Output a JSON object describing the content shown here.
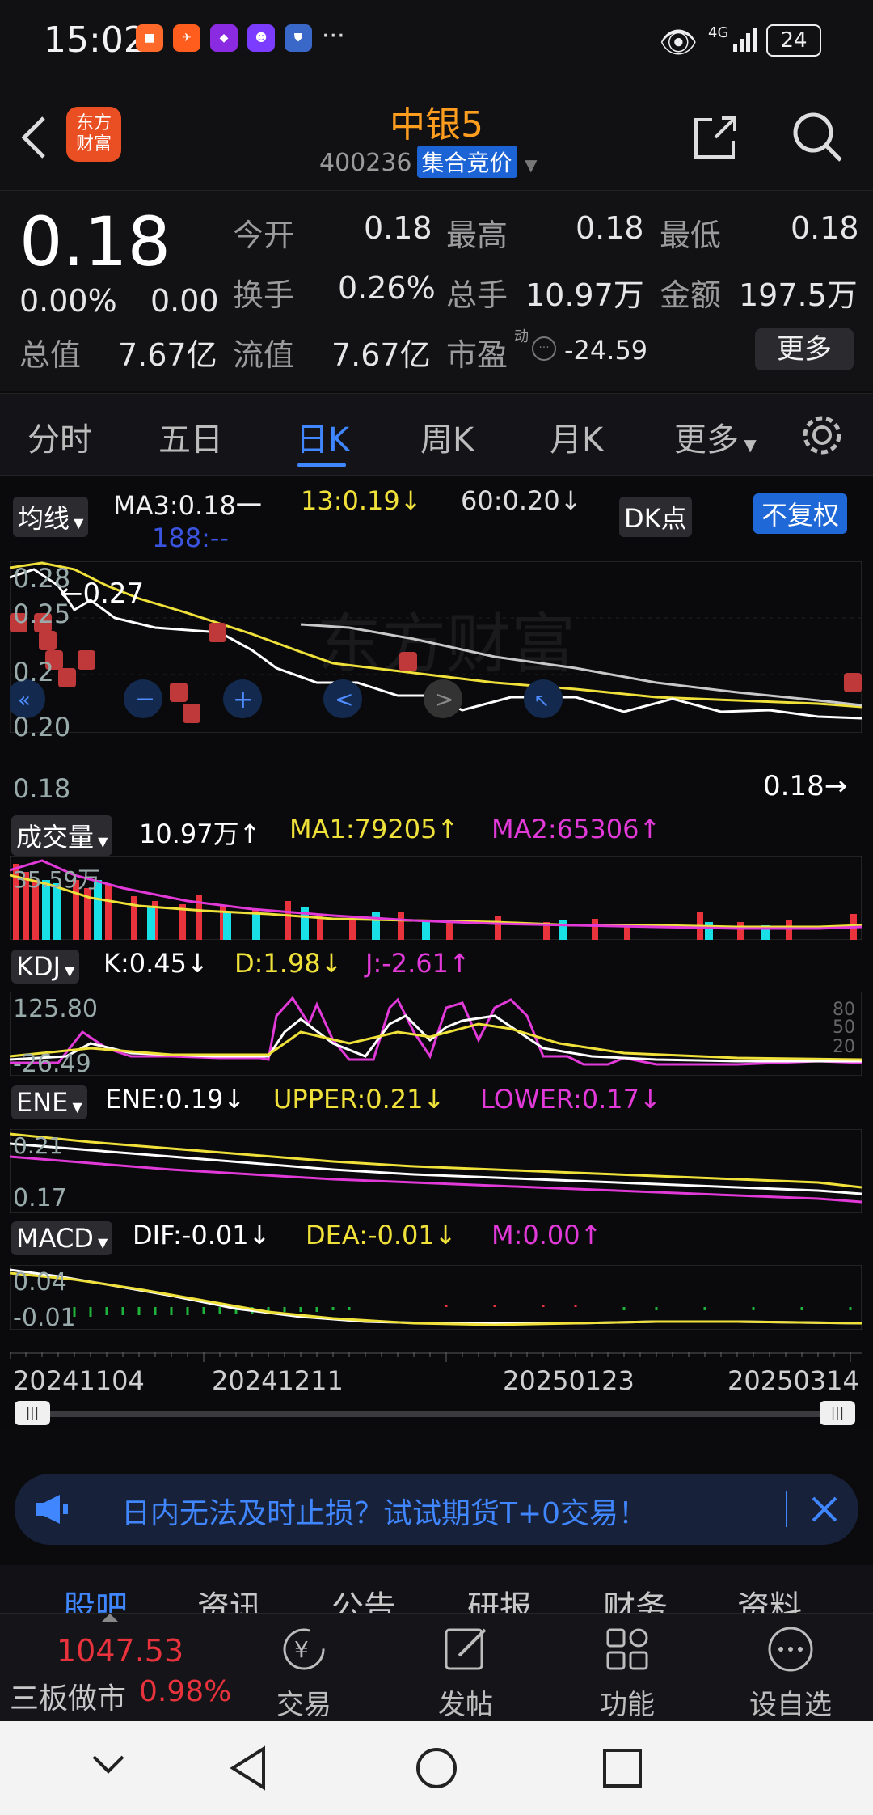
{
  "status_bar": {
    "time": "15:02",
    "network": "4G",
    "battery": "24"
  },
  "header": {
    "title": "中银5",
    "code": "400236",
    "auction_badge": "集合竞价",
    "logo_line1": "东方",
    "logo_line2": "财富"
  },
  "quote": {
    "price": "0.18",
    "change_pct": "0.00%",
    "change": "0.00",
    "labels": {
      "open": "今开",
      "high": "最高",
      "low": "最低",
      "turnover": "换手",
      "volume": "总手",
      "amount": "金额",
      "total_value": "总值",
      "float_value": "流值",
      "pe": "市盈",
      "pe_mark": "动"
    },
    "values": {
      "open": "0.18",
      "high": "0.18",
      "low": "0.18",
      "turnover": "0.26%",
      "volume": "10.97万",
      "amount": "197.5万",
      "total_value": "7.67亿",
      "float_value": "7.67亿",
      "pe": "-24.59"
    },
    "more_button": "更多"
  },
  "tabs": [
    "分时",
    "五日",
    "日K",
    "周K",
    "月K",
    "更多"
  ],
  "kline": {
    "indicator_selector": "均线",
    "ma3": "MA3:0.18一",
    "ma13": "13:0.19↓",
    "ma60": "60:0.20↓",
    "ma188": "188:--",
    "dk_button": "DK点",
    "fq_button": "不复权",
    "y_labels": [
      "0.28",
      "0.25",
      "0.2",
      "0.20",
      "0.18"
    ],
    "max_label": "←0.27",
    "last_label": "0.18→"
  },
  "volume": {
    "selector": "成交量",
    "value": "10.97万↑",
    "ma1": "MA1:79205↑",
    "ma2": "MA2:65306↑",
    "top_label": "35.59万"
  },
  "kdj": {
    "selector": "KDJ",
    "k": "K:0.45↓",
    "d": "D:1.98↓",
    "j": "J:-2.61↑",
    "top_label": "125.80",
    "bottom_label": "-26.49",
    "right_labels": [
      "80",
      "50",
      "20"
    ]
  },
  "ene": {
    "selector": "ENE",
    "ene": "ENE:0.19↓",
    "upper": "UPPER:0.21↓",
    "lower": "LOWER:0.17↓",
    "top_label": "0.21",
    "bottom_label": "0.17"
  },
  "macd": {
    "selector": "MACD",
    "dif": "DIF:-0.01↓",
    "dea": "DEA:-0.01↓",
    "m": "M:0.00↑",
    "top_label": "0.04",
    "bottom_label": "-0.01"
  },
  "dates": [
    "20241104",
    "20241211",
    "20250123",
    "20250314"
  ],
  "banner": {
    "text": "日内无法及时止损？试试期货T+0交易！"
  },
  "bottom_tabs": [
    "股吧",
    "资讯",
    "公告",
    "研报",
    "财务",
    "资料"
  ],
  "dock": {
    "index_value": "1047.53",
    "index_name": "三板做市",
    "index_change": "0.98%",
    "items": [
      "交易",
      "发帖",
      "功能",
      "设自选"
    ]
  },
  "colors": {
    "accent_blue": "#3f86ff",
    "title_orange": "#ff9d1f",
    "up_red": "#e8323c",
    "down_cyan": "#19e0e6",
    "ma_yellow": "#f0e13a",
    "magenta": "#e23ad8"
  }
}
